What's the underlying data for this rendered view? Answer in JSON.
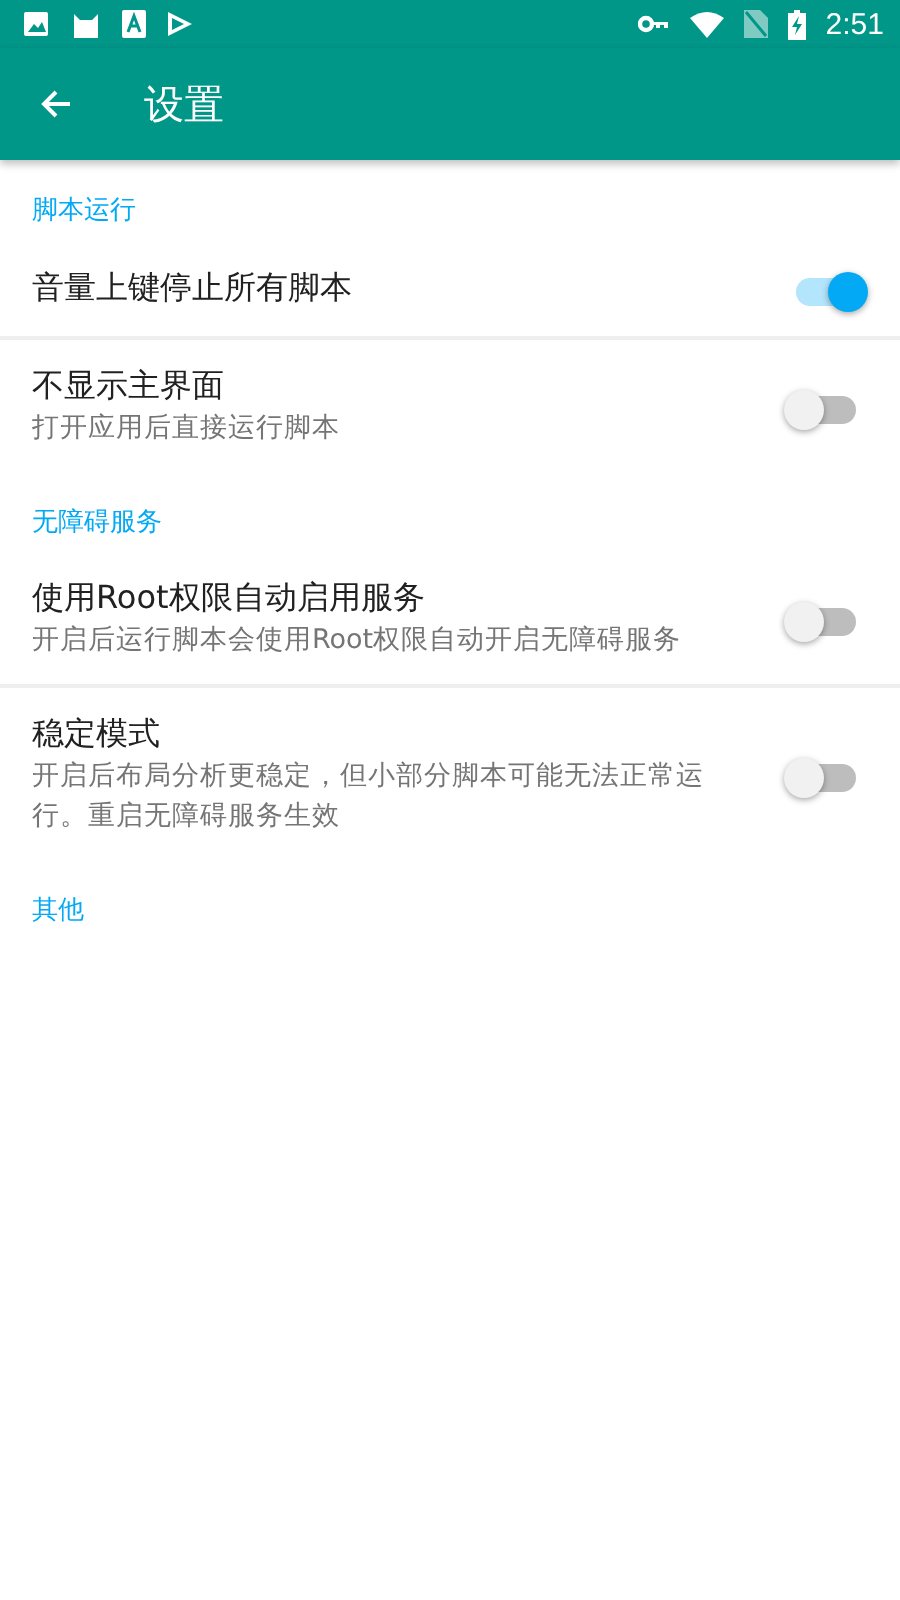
{
  "status_bar": {
    "time": "2:51"
  },
  "app_bar": {
    "title": "设置"
  },
  "sections": [
    {
      "title": "脚本运行",
      "items": [
        {
          "title": "音量上键停止所有脚本",
          "on": true
        },
        {
          "title": "不显示主界面",
          "summary": "打开应用后直接运行脚本",
          "on": false
        }
      ]
    },
    {
      "title": "无障碍服务",
      "items": [
        {
          "title": "使用Root权限自动启用服务",
          "summary": "开启后运行脚本会使用Root权限自动开启无障碍服务",
          "on": false
        },
        {
          "title": "稳定模式",
          "summary": "开启后布局分析更稳定，但小部分脚本可能无法正常运行。重启无障碍服务生效",
          "on": false
        }
      ]
    },
    {
      "title": "其他"
    }
  ]
}
